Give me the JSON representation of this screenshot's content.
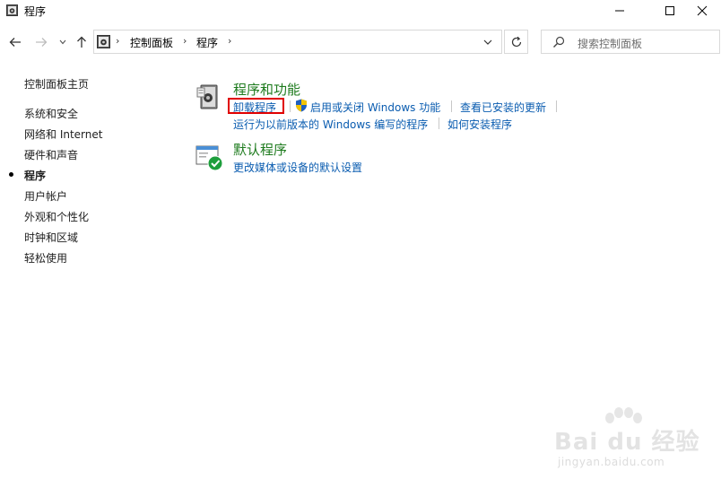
{
  "window": {
    "title": "程序"
  },
  "nav": {
    "breadcrumb": [
      "控制面板",
      "程序"
    ],
    "search_placeholder": "搜索控制面板"
  },
  "sidebar": {
    "home": "控制面板主页",
    "items": [
      {
        "label": "系统和安全"
      },
      {
        "label": "网络和 Internet"
      },
      {
        "label": "硬件和声音"
      },
      {
        "label": "程序",
        "current": true
      },
      {
        "label": "用户帐户"
      },
      {
        "label": "外观和个性化"
      },
      {
        "label": "时钟和区域"
      },
      {
        "label": "轻松使用"
      }
    ]
  },
  "groups": [
    {
      "title": "程序和功能",
      "links_row1": [
        "卸载程序",
        "启用或关闭 Windows 功能",
        "查看已安装的更新"
      ],
      "links_row2": [
        "运行为以前版本的 Windows 编写的程序",
        "如何安装程序"
      ],
      "icon": "programs-features-icon"
    },
    {
      "title": "默认程序",
      "links_row1": [
        "更改媒体或设备的默认设置"
      ],
      "icon": "default-programs-icon"
    }
  ],
  "highlight": {
    "target": "卸载程序",
    "color": "#e00000"
  },
  "colors": {
    "group_title": "#1e7b1e",
    "link": "#0a5cb0"
  },
  "watermark": {
    "brand": "Bai du 经验",
    "url": "jingyan.baidu.com"
  }
}
